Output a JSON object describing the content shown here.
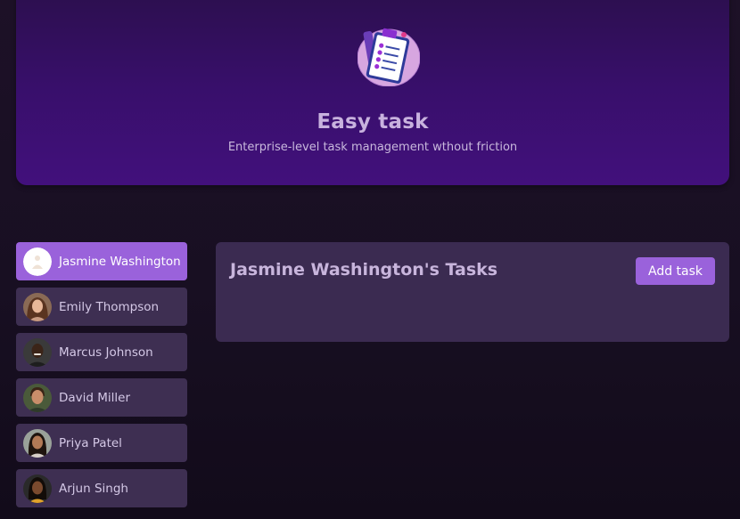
{
  "header": {
    "logo_icon": "clipboard-checklist-icon",
    "title": "Easy task",
    "subtitle": "Enterprise-level task management wthout friction"
  },
  "users": [
    {
      "name": "Jasmine Washington",
      "active": true,
      "avatar": "placeholder-avatar-icon"
    },
    {
      "name": "Emily Thompson",
      "active": false,
      "avatar": "user-photo"
    },
    {
      "name": "Marcus Johnson",
      "active": false,
      "avatar": "user-photo"
    },
    {
      "name": "David Miller",
      "active": false,
      "avatar": "user-photo"
    },
    {
      "name": "Priya Patel",
      "active": false,
      "avatar": "user-photo"
    },
    {
      "name": "Arjun Singh",
      "active": false,
      "avatar": "user-photo"
    }
  ],
  "tasks": {
    "title": "Jasmine Washington's Tasks",
    "add_button": "Add task"
  },
  "colors": {
    "accent": "#9a62db",
    "header_top": "#2c0f4e",
    "header_bottom": "#42107c",
    "card": "#3e2f52",
    "panel": "#3b2b51"
  }
}
